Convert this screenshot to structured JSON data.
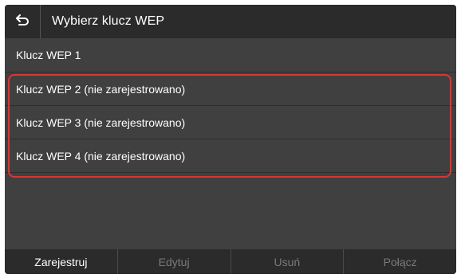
{
  "header": {
    "back_icon": "back-arrow-icon",
    "title": "Wybierz klucz WEP"
  },
  "list": {
    "items": [
      {
        "label": "Klucz WEP 1"
      },
      {
        "label": "Klucz WEP 2 (nie zarejestrowano)"
      },
      {
        "label": "Klucz WEP 3 (nie zarejestrowano)"
      },
      {
        "label": "Klucz WEP 4 (nie zarejestrowano)"
      }
    ]
  },
  "footer": {
    "register_label": "Zarejestruj",
    "edit_label": "Edytuj",
    "delete_label": "Usuń",
    "connect_label": "Połącz"
  },
  "colors": {
    "highlight": "#e8302f",
    "background": "#404040",
    "header": "#2b2b2b",
    "disabled_text": "#7a7a7a"
  }
}
